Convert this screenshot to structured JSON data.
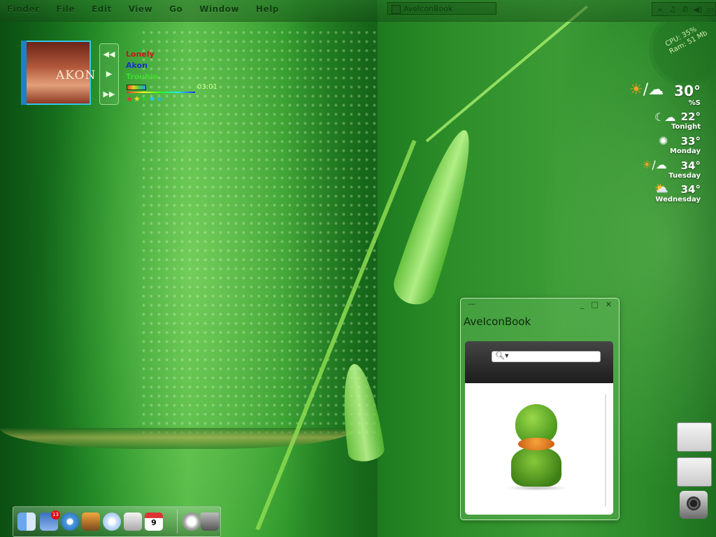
{
  "menubar": {
    "items": [
      "Finder",
      "File",
      "Edit",
      "View",
      "Go",
      "Window",
      "Help"
    ],
    "active_window_title": "AveIconBook",
    "tray_icons": [
      "chevron-left-icon",
      "music-icon",
      "phone-icon",
      "volume-icon",
      "network-icon"
    ]
  },
  "system_monitor": {
    "cpu": "CPU: 35%",
    "ram": "Ram: 51 Mb"
  },
  "music_player": {
    "album_art_text": "AKON",
    "track_title": "Lonely",
    "artist": "Akon",
    "album": "Trouble",
    "time": "03:01",
    "rating_stars": 5,
    "colors": {
      "title": "#c41a1a",
      "artist": "#1b30c8",
      "album": "#3ddc2b"
    }
  },
  "weather": {
    "current": {
      "temp": "30°",
      "condition": "%S",
      "icon": "sun-cloud-icon"
    },
    "forecast": [
      {
        "label": "Tonight",
        "temp": "22°",
        "icon": "moon-cloud-icon"
      },
      {
        "label": "Monday",
        "temp": "33°",
        "icon": "sun-icon"
      },
      {
        "label": "Tuesday",
        "temp": "34°",
        "icon": "sun-cloud-icon"
      },
      {
        "label": "Wednesday",
        "temp": "34°",
        "icon": "partly-cloudy-icon"
      }
    ]
  },
  "window": {
    "title": "AveIconBook",
    "search_placeholder": "",
    "preview": "duck-icon"
  },
  "dock": {
    "items": [
      "finder-icon",
      "mail-icon",
      "safari-icon",
      "iphoto-icon",
      "itunes-icon",
      "system-prefs-icon",
      "ical-icon",
      "mail-stamp-icon",
      "trash-icon"
    ],
    "mail_badge": "13",
    "ical_day": "9"
  }
}
